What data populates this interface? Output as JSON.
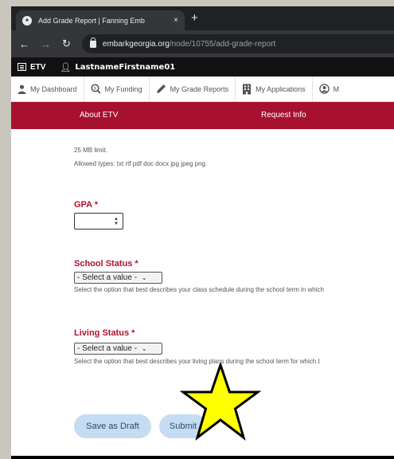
{
  "browser": {
    "tab_title": "Add Grade Report | Fanning Emb",
    "tab_close": "×",
    "new_tab": "+",
    "url_host": "embarkgeorgia.org",
    "url_path": "/node/10755/add-grade-report"
  },
  "site": {
    "etv_label": "ETV",
    "user_name": "LastnameFirstname01"
  },
  "dashnav": {
    "items": [
      {
        "label": "My Dashboard",
        "icon": "person-icon"
      },
      {
        "label": "My Funding",
        "icon": "search-dollar-icon"
      },
      {
        "label": "My Grade Reports",
        "icon": "pencil-icon"
      },
      {
        "label": "My Applications",
        "icon": "building-icon"
      },
      {
        "label": "M",
        "icon": "user-circle-icon"
      }
    ]
  },
  "menu": {
    "about": "About ETV",
    "request": "Request Info"
  },
  "form": {
    "limit_note": "25 MB limit.",
    "types_note": "Allowed types: txt rtf pdf doc docx jpg jpeg png.",
    "gpa_label": "GPA",
    "required_mark": "*",
    "gpa_value": "",
    "school_label": "School Status",
    "school_value": "- Select a value -",
    "school_help": "Select the option that best describes your class schedule during the school term in which",
    "living_label": "Living Status",
    "living_value": "- Select a value -",
    "living_help": "Select the option that best describes your living plans during the school term for which t"
  },
  "buttons": {
    "draft": "Save as Draft",
    "submit": "Submit"
  },
  "colors": {
    "brand_red": "#a8102f",
    "button_bg": "#c5dcf3",
    "highlight_star": "#ffff00"
  }
}
